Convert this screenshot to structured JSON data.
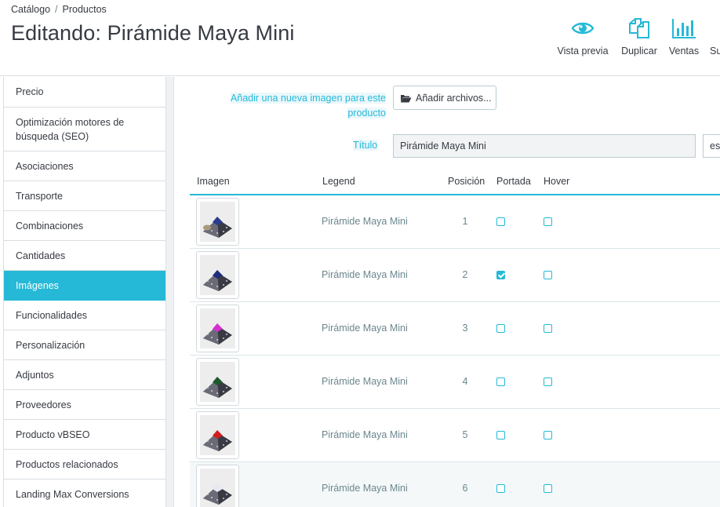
{
  "breadcrumb": {
    "parent": "Catálogo",
    "separator": "/",
    "current": "Productos"
  },
  "page_title": "Editando: Pirámide Maya Mini",
  "toolbar": {
    "preview_label": "Vista previa",
    "duplicate_label": "Duplicar",
    "sales_label": "Ventas",
    "truncated_label": "Su"
  },
  "sidebar": {
    "items": [
      {
        "label": "Precio"
      },
      {
        "label": "Optimización motores de búsqueda (SEO)"
      },
      {
        "label": "Asociaciones"
      },
      {
        "label": "Transporte"
      },
      {
        "label": "Combinaciones"
      },
      {
        "label": "Cantidades"
      },
      {
        "label": "Imágenes",
        "active": true
      },
      {
        "label": "Funcionalidades"
      },
      {
        "label": "Personalización"
      },
      {
        "label": "Adjuntos"
      },
      {
        "label": "Proveedores"
      },
      {
        "label": "Producto vBSEO"
      },
      {
        "label": "Productos relacionados"
      },
      {
        "label": "Landing Max Conversions"
      }
    ]
  },
  "form": {
    "upload_label": "Añadir una nueva imagen para este producto",
    "upload_button": "Añadir archivos...",
    "title_label": "Título",
    "title_value": "Pirámide Maya Mini",
    "language": "es"
  },
  "table": {
    "headers": {
      "image": "Imagen",
      "legend": "Legend",
      "position": "Posición",
      "cover": "Portada",
      "hover": "Hover"
    },
    "rows": [
      {
        "legend": "Pirámide Maya Mini",
        "position": "1",
        "cover": false,
        "hover": false,
        "accent": "#2a3a8f"
      },
      {
        "legend": "Pirámide Maya Mini",
        "position": "2",
        "cover": true,
        "hover": false,
        "accent": "#1f2d7a"
      },
      {
        "legend": "Pirámide Maya Mini",
        "position": "3",
        "cover": false,
        "hover": false,
        "accent": "#d62fd0"
      },
      {
        "legend": "Pirámide Maya Mini",
        "position": "4",
        "cover": false,
        "hover": false,
        "accent": "#1c5a2c"
      },
      {
        "legend": "Pirámide Maya Mini",
        "position": "5",
        "cover": false,
        "hover": false,
        "accent": "#d11f1f"
      },
      {
        "legend": "Pirámide Maya Mini",
        "position": "6",
        "cover": false,
        "hover": false,
        "accent": "#e8e8f0"
      }
    ]
  },
  "colors": {
    "accent": "#25b9d7",
    "text": "#363a41",
    "muted": "#6c868e",
    "border": "#d9dee2"
  }
}
